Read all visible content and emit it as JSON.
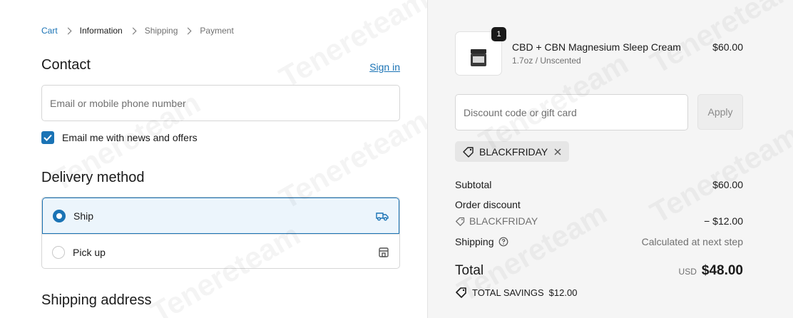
{
  "breadcrumb": {
    "items": [
      "Cart",
      "Information",
      "Shipping",
      "Payment"
    ]
  },
  "contact": {
    "title": "Contact",
    "sign_in": "Sign in",
    "email_placeholder": "Email or mobile phone number",
    "newsletter_label": "Email me with news and offers",
    "newsletter_checked": true
  },
  "delivery": {
    "title": "Delivery method",
    "options": [
      {
        "label": "Ship",
        "selected": true,
        "icon": "truck-icon"
      },
      {
        "label": "Pick up",
        "selected": false,
        "icon": "store-icon"
      }
    ]
  },
  "shipping_address": {
    "title": "Shipping address"
  },
  "order": {
    "item": {
      "quantity": "1",
      "name": "CBD + CBN Magnesium Sleep Cream",
      "variant": "1.7oz / Unscented",
      "price": "$60.00"
    },
    "discount_placeholder": "Discount code or gift card",
    "apply_label": "Apply",
    "applied_code": "BLACKFRIDAY",
    "summary": {
      "subtotal_label": "Subtotal",
      "subtotal_value": "$60.00",
      "order_discount_label": "Order discount",
      "discount_code": "BLACKFRIDAY",
      "discount_value": "− $12.00",
      "shipping_label": "Shipping",
      "shipping_value": "Calculated at next step",
      "total_label": "Total",
      "currency": "USD",
      "total_value": "$48.00",
      "savings_label": "TOTAL SAVINGS",
      "savings_value": "$12.00"
    }
  },
  "watermark_text": "Tenereteam",
  "colors": {
    "accent": "#1a73b5",
    "panel_bg": "#f5f5f5",
    "selected_bg": "#ecf5fc"
  }
}
